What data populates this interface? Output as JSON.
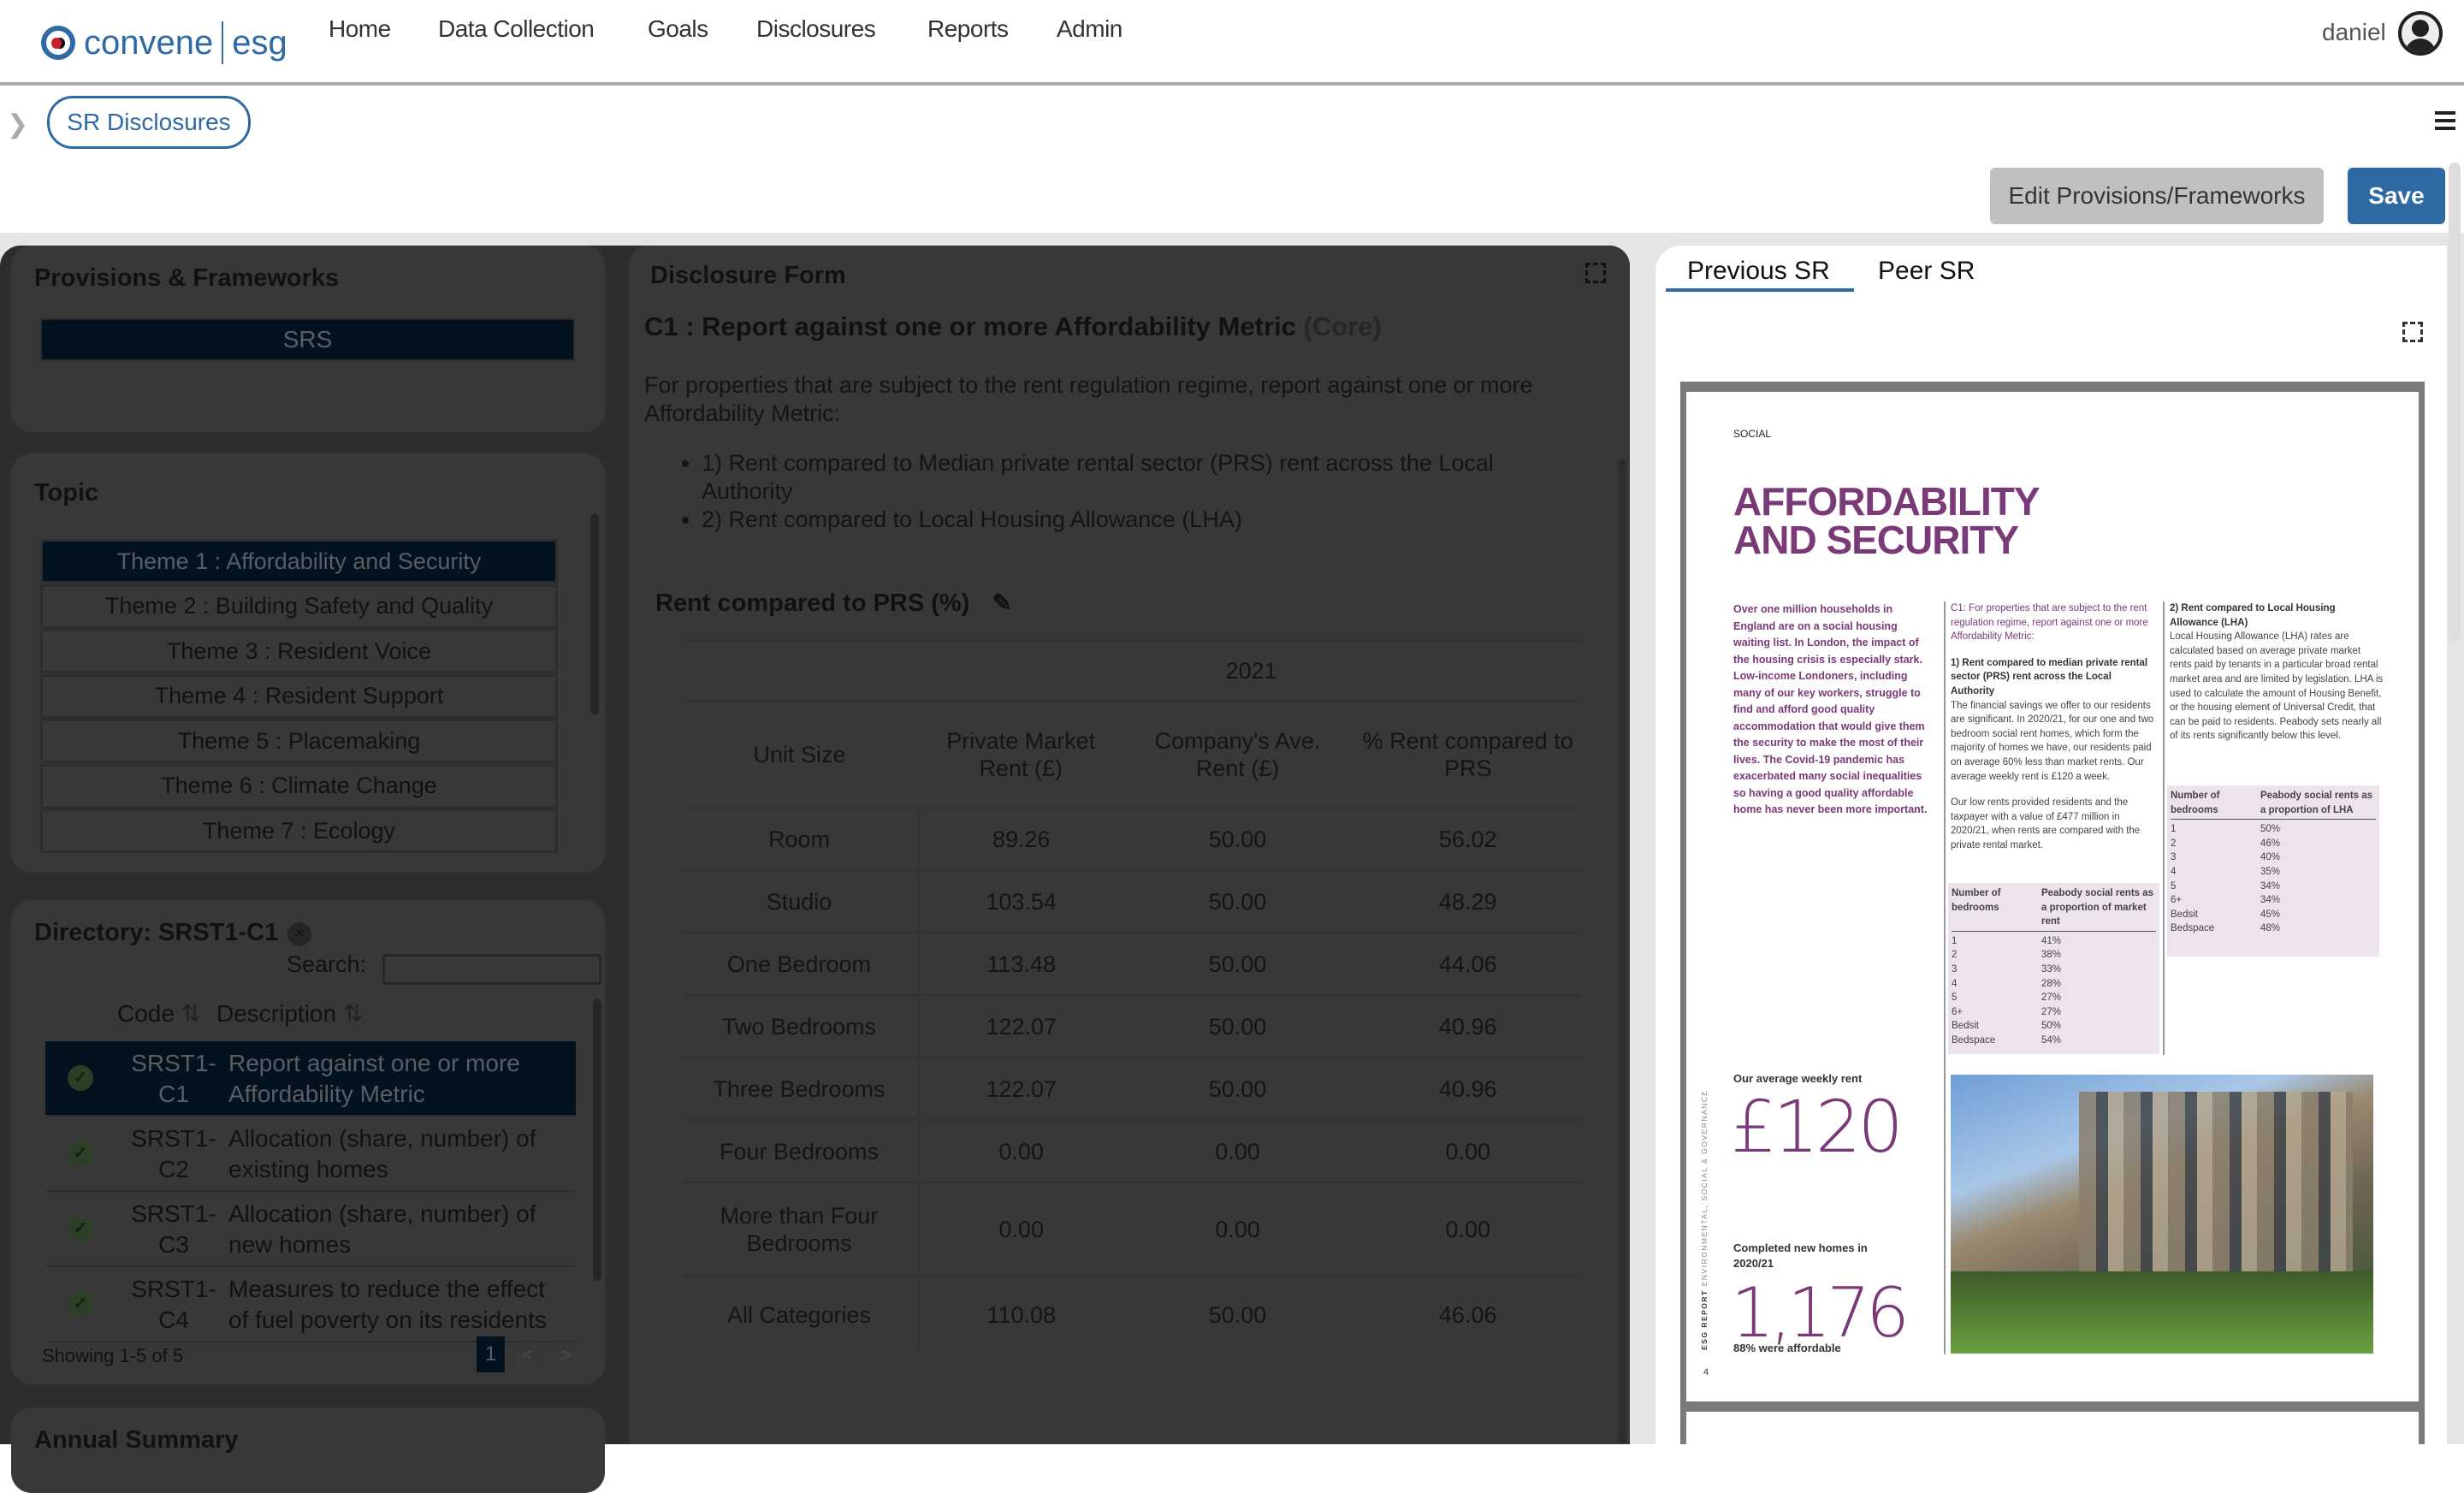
{
  "header": {
    "logo_brand": "convene",
    "logo_product": "esg",
    "nav": [
      "Home",
      "Data Collection",
      "Goals",
      "Disclosures",
      "Reports",
      "Admin"
    ],
    "user_name": "daniel"
  },
  "breadcrumb": {
    "current": "SR Disclosures"
  },
  "toolbar": {
    "edit_label": "Edit Provisions/Frameworks",
    "save_label": "Save"
  },
  "colors": {
    "brand": "#2f6aa5",
    "selected": "#0a528d",
    "report_purple": "#7a3a78"
  },
  "provisions": {
    "title": "Provisions & Frameworks",
    "selected": "SRS"
  },
  "topic": {
    "title": "Topic",
    "items": [
      "Theme 1 : Affordability and Security",
      "Theme 2 : Building Safety and Quality",
      "Theme 3 : Resident Voice",
      "Theme 4 : Resident Support",
      "Theme 5 : Placemaking",
      "Theme 6 : Climate Change",
      "Theme 7 : Ecology"
    ],
    "selected_index": 0
  },
  "directory": {
    "title": "Directory: SRST1-C1",
    "search_label": "Search:",
    "search_value": "",
    "columns": [
      "Code",
      "Description"
    ],
    "rows": [
      {
        "code_1": "SRST1-",
        "code_2": "C1",
        "desc": "Report against one or more Affordability Metric",
        "status": "complete",
        "selected": true
      },
      {
        "code_1": "SRST1-",
        "code_2": "C2",
        "desc": "Allocation (share, number) of existing homes",
        "status": "complete"
      },
      {
        "code_1": "SRST1-",
        "code_2": "C3",
        "desc": "Allocation (share, number) of new homes",
        "status": "complete"
      },
      {
        "code_1": "SRST1-",
        "code_2": "C4",
        "desc": "Measures to reduce the effect of fuel poverty on its residents",
        "status": "complete"
      }
    ],
    "showing": "Showing 1-5 of 5",
    "page": "1",
    "prev": "<",
    "next": ">"
  },
  "annual_summary": {
    "title": "Annual Summary"
  },
  "disclosure": {
    "panel_title": "Disclosure Form",
    "heading": "C1 : Report against one or more Affordability Metric",
    "heading_tag": "(Core)",
    "intro": "For properties that are subject to the rent regulation regime, report against one or more Affordability Metric:",
    "bullets": [
      "1) Rent compared to Median private rental sector (PRS) rent across the Local Authority",
      "2) Rent compared to Local Housing Allowance (LHA)"
    ],
    "table_title": "Rent compared to PRS (%)",
    "year": "2021",
    "columns": [
      "Unit Size",
      "Private Market Rent (£)",
      "Company's Ave. Rent (£)",
      "% Rent compared to PRS"
    ],
    "rows": [
      [
        "Room",
        "89.26",
        "50.00",
        "56.02"
      ],
      [
        "Studio",
        "103.54",
        "50.00",
        "48.29"
      ],
      [
        "One Bedroom",
        "113.48",
        "50.00",
        "44.06"
      ],
      [
        "Two Bedrooms",
        "122.07",
        "50.00",
        "40.96"
      ],
      [
        "Three Bedrooms",
        "122.07",
        "50.00",
        "40.96"
      ],
      [
        "Four Bedrooms",
        "0.00",
        "0.00",
        "0.00"
      ],
      [
        "More than Four Bedrooms",
        "0.00",
        "0.00",
        "0.00"
      ],
      [
        "All Categories",
        "110.08",
        "50.00",
        "46.06"
      ]
    ]
  },
  "reference": {
    "tabs": [
      "Previous SR",
      "Peer SR"
    ],
    "active_tab": "Previous SR",
    "doc": {
      "section": "SOCIAL",
      "title_1": "AFFORDABILITY",
      "title_2": "AND SECURITY",
      "intro": "Over one million households in England are on a social housing waiting list. In London, the impact of the housing crisis is especially stark. Low-income Londoners, including many of our key workers, struggle to find and afford good quality accommodation that would give them the security to make the most of their lives. The Covid-19 pandemic has exacerbated many social inequalities so having a good quality affordable home has never been more important.",
      "c1_lead": "C1: For properties that are subject to the rent regulation regime, report against one or more Affordability Metric:",
      "c1_point": "1) Rent compared to median private rental sector (PRS) rent across the Local Authority",
      "c1_body_1": "The financial savings we offer to our residents are significant. In 2020/21, for our one and two bedroom social rent homes, which form the majority of homes we have, our residents paid on average 60% less than market rents. Our average weekly rent is £120 a week.",
      "c1_body_2": "Our low rents provided residents and the taxpayer with a value of £477 million in 2020/21, when rents are compared with the private rental market.",
      "prs_table": {
        "col_1": "Number of bedrooms",
        "col_2": "Peabody social rents as a proportion of market rent",
        "rows": [
          [
            "1",
            "41%"
          ],
          [
            "2",
            "38%"
          ],
          [
            "3",
            "33%"
          ],
          [
            "4",
            "28%"
          ],
          [
            "5",
            "27%"
          ],
          [
            "6+",
            "27%"
          ],
          [
            "Bedsit",
            "50%"
          ],
          [
            "Bedspace",
            "54%"
          ]
        ]
      },
      "lha_point": "2) Rent compared to Local Housing Allowance (LHA)",
      "lha_body": "Local Housing Allowance (LHA) rates are calculated based on average private market rents paid by tenants in a particular broad rental market area and are limited by legislation. LHA is used to calculate the amount of Housing Benefit, or the housing element of Universal Credit, that can be paid to residents. Peabody sets nearly all of its rents significantly below this level.",
      "lha_table": {
        "col_1": "Number of bedrooms",
        "col_2": "Peabody social rents as a proportion of LHA",
        "rows": [
          [
            "1",
            "50%"
          ],
          [
            "2",
            "46%"
          ],
          [
            "3",
            "40%"
          ],
          [
            "4",
            "35%"
          ],
          [
            "5",
            "34%"
          ],
          [
            "6+",
            "34%"
          ],
          [
            "Bedsit",
            "45%"
          ],
          [
            "Bedspace",
            "48%"
          ]
        ]
      },
      "stat_1_label": "Our average weekly rent",
      "stat_1_value": "£120",
      "stat_2_label": "Completed new homes in 2020/21",
      "stat_2_value": "1,176",
      "stat_2_note": "88% were affordable",
      "side_label_bold": "ESG REPORT",
      "side_label": "ENVIRONMENTAL, SOCIAL & GOVERNANCE",
      "page_number": "4"
    }
  }
}
